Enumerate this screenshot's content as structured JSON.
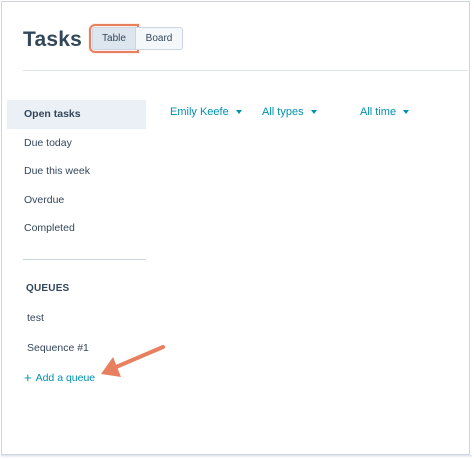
{
  "header": {
    "title": "Tasks",
    "view_toggle": {
      "table_label": "Table",
      "board_label": "Board",
      "selected": "Table"
    }
  },
  "sidebar": {
    "items": [
      {
        "label": "Open tasks",
        "active": true
      },
      {
        "label": "Due today",
        "active": false
      },
      {
        "label": "Due this week",
        "active": false
      },
      {
        "label": "Overdue",
        "active": false
      },
      {
        "label": "Completed",
        "active": false
      }
    ],
    "queues_heading": "QUEUES",
    "queues": [
      "test",
      "Sequence #1"
    ],
    "add_queue_label": "Add a queue"
  },
  "filters": {
    "owner": "Emily Keefe",
    "type": "All types",
    "time": "All time"
  },
  "colors": {
    "link": "#0091ae",
    "text": "#33475b",
    "active_bg": "#eaf0f6",
    "highlight": "#e8805f"
  }
}
